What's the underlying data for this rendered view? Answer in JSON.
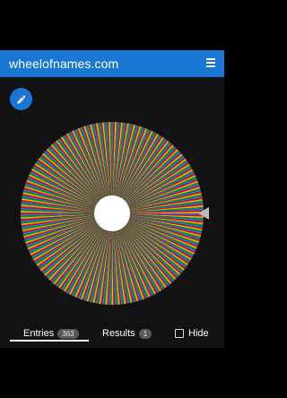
{
  "app": {
    "title": "wheelofnames.com"
  },
  "wheel": {
    "entry_count": 363,
    "segment_colors": [
      "#3369E8",
      "#D50F25",
      "#EEB211",
      "#009925"
    ]
  },
  "tabs": [
    {
      "label": "Entries",
      "count": "363",
      "active": true
    },
    {
      "label": "Results",
      "count": "1",
      "active": false
    }
  ],
  "hide": {
    "label": "Hide",
    "checked": false
  },
  "colors": {
    "accent": "#1976D2",
    "background": "#121212"
  }
}
